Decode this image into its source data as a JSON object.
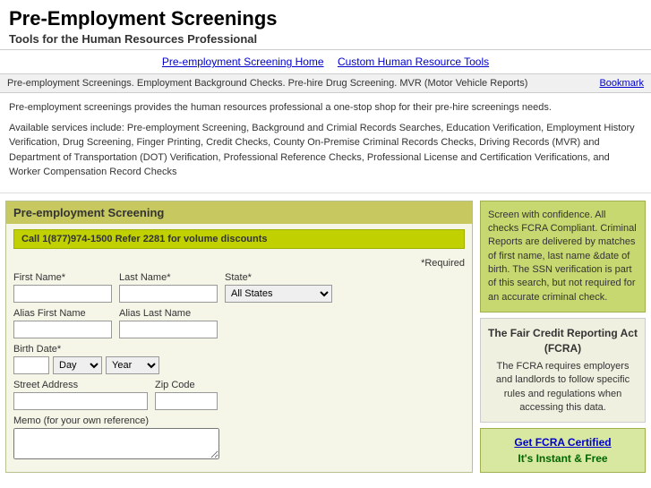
{
  "header": {
    "title": "Pre-Employment Screenings",
    "subtitle": "Tools for the Human Resources Professional"
  },
  "nav": {
    "link1_label": "Pre-employment Screening Home",
    "link2_label": "Custom Human Resource Tools"
  },
  "breadcrumb": {
    "text": "Pre-employment Screenings. Employment Background Checks. Pre-hire Drug Screening. MVR (Motor Vehicle Reports)",
    "bookmark_label": "Bookmark"
  },
  "description": {
    "para1": "Pre-employment screenings provides the human resources professional a one-stop shop for their pre-hire screenings needs.",
    "para2": "Available services include: Pre-employment Screening, Background and Crimial Records Searches, Education Verification, Employment History Verification, Drug Screening, Finger Printing, Credit Checks, County On-Premise Criminal Records Checks, Driving Records (MVR) and Department of Transportation (DOT) Verification, Professional Reference Checks, Professional License and Certification Verifications, and Worker Compensation Record Checks"
  },
  "form_panel": {
    "header": "Pre-employment Screening",
    "promo": "Call 1(877)974-1500 Refer 2281 for volume discounts",
    "required_note": "*Required",
    "fields": {
      "first_name_label": "First Name*",
      "last_name_label": "Last Name*",
      "state_label": "State*",
      "state_default": "All States",
      "alias_first_label": "Alias First Name",
      "alias_last_label": "Alias Last Name",
      "birth_date_label": "Birth Date*",
      "birth_day_default": "Day",
      "birth_year_default": "Year",
      "address_label": "Street Address",
      "zip_label": "Zip Code",
      "memo_label": "Memo (for your own reference)"
    }
  },
  "right_panel": {
    "fcra_info": "Screen with confidence. All checks FCRA Compliant. Criminal Reports are delivered by matches of first name, last name &date of birth. The SSN verification is part of this search, but not required for an accurate criminal check.",
    "fcra_act_title": "The Fair Credit Reporting Act (FCRA)",
    "fcra_act_text": "The FCRA requires employers and landlords to follow specific rules and regulations when accessing this data.",
    "fcra_certified_line1": "Get FCRA Certified",
    "fcra_certified_line2": "It's Instant & Free"
  }
}
